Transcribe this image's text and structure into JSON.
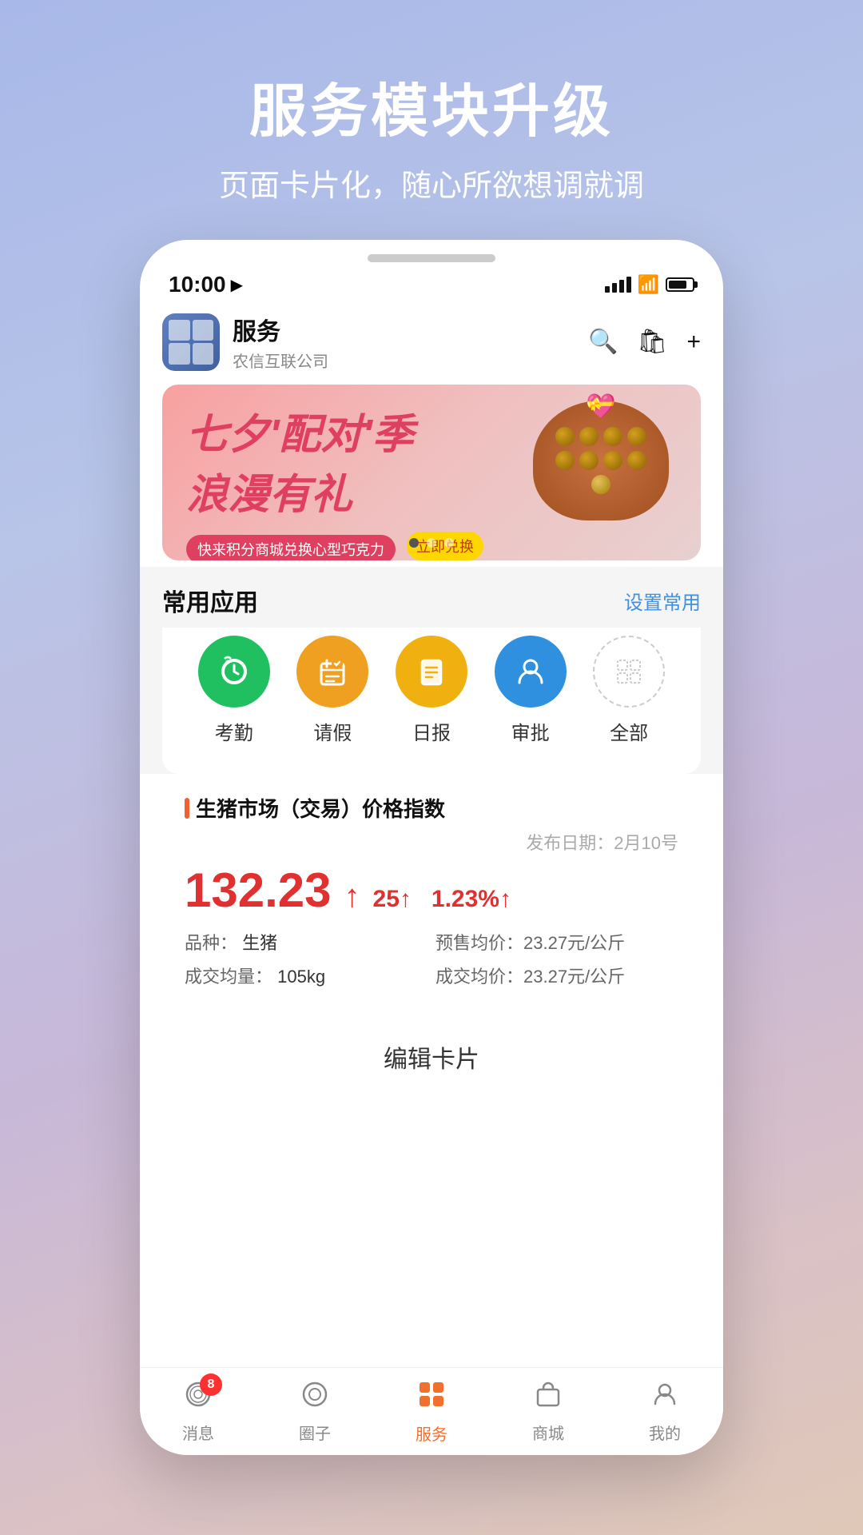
{
  "promo": {
    "title": "服务模块升级",
    "subtitle": "页面卡片化，随心所欲想调就调"
  },
  "status_bar": {
    "time": "10:00",
    "location_icon": "▶"
  },
  "app_header": {
    "name": "服务",
    "company": "农信互联公司",
    "search_label": "search",
    "bag_label": "shopping-bag",
    "plus_label": "plus"
  },
  "banner": {
    "line1": "七夕'配对'季",
    "line2": "浪漫有礼",
    "sub_text": "快来积分商城兑换心型巧克力",
    "cta_text": "立即兑换",
    "dots": [
      true,
      false,
      false
    ]
  },
  "common_apps": {
    "title": "常用应用",
    "action": "设置常用",
    "items": [
      {
        "label": "考勤",
        "color": "green",
        "icon": "📶"
      },
      {
        "label": "请假",
        "color": "orange",
        "icon": "📅"
      },
      {
        "label": "日报",
        "color": "amber",
        "icon": "📋"
      },
      {
        "label": "审批",
        "color": "blue",
        "icon": "👤"
      },
      {
        "label": "全部",
        "color": "outline",
        "icon": "⊞"
      }
    ]
  },
  "price_index": {
    "title": "生猪市场（交易）价格指数",
    "date_label": "发布日期：2月10号",
    "main_value": "132.23",
    "main_arrow": "↑",
    "change_value": "25↑",
    "change_pct": "1.23%↑",
    "variety_label": "品种：",
    "variety_value": "生猪",
    "volume_label": "成交均量：",
    "volume_value": "105kg",
    "presale_label": "预售均价：23.27元/公斤",
    "trade_label": "成交均价：23.27元/公斤"
  },
  "edit_card": {
    "label": "编辑卡片"
  },
  "bottom_nav": {
    "items": [
      {
        "label": "消息",
        "icon": "💬",
        "badge": "8",
        "active": false
      },
      {
        "label": "圈子",
        "icon": "◎",
        "badge": null,
        "active": false
      },
      {
        "label": "服务",
        "icon": "⊞",
        "badge": null,
        "active": true
      },
      {
        "label": "商城",
        "icon": "🛍",
        "badge": null,
        "active": false
      },
      {
        "label": "我的",
        "icon": "👤",
        "badge": null,
        "active": false
      }
    ]
  }
}
